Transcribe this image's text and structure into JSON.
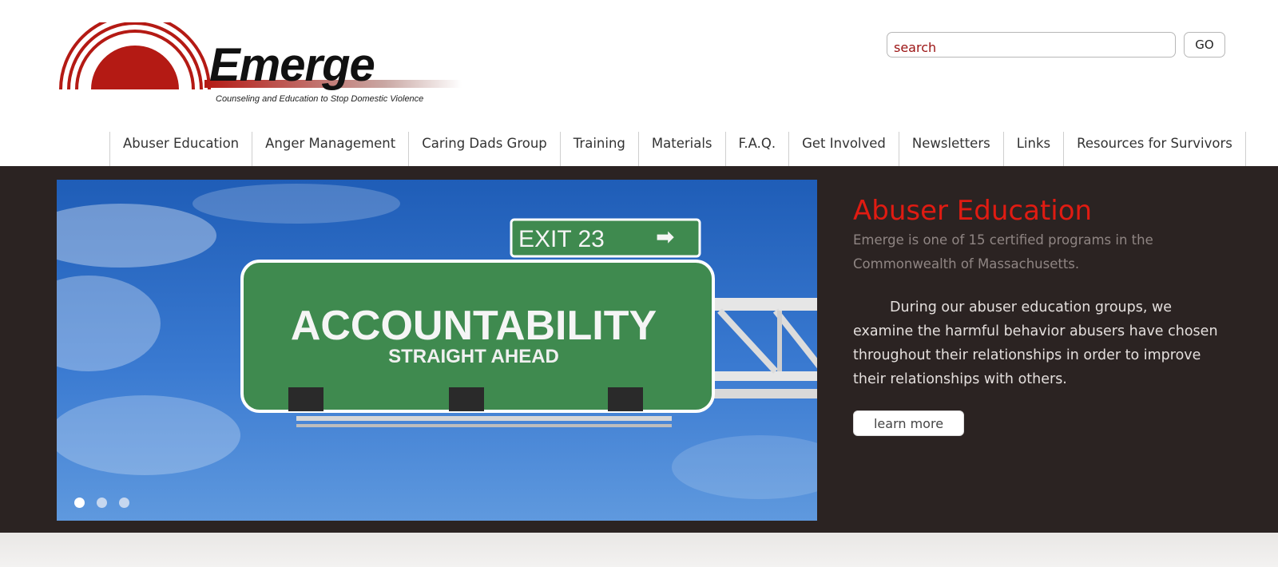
{
  "logo": {
    "wordmark": "Emerge",
    "tagline": "Counseling and Education to Stop Domestic Violence"
  },
  "search": {
    "placeholder": "search",
    "go_label": "GO"
  },
  "nav": {
    "items": [
      {
        "label": "Abuser Education"
      },
      {
        "label": "Anger Management"
      },
      {
        "label": "Caring Dads Group"
      },
      {
        "label": "Training"
      },
      {
        "label": "Materials"
      },
      {
        "label": "F.A.Q."
      },
      {
        "label": "Get Involved"
      },
      {
        "label": "Newsletters"
      },
      {
        "label": "Links"
      },
      {
        "label": "Resources for Survivors"
      }
    ]
  },
  "hero": {
    "sign_main": "ACCOUNTABILITY",
    "sign_sub": "STRAIGHT AHEAD",
    "exit_sign": "EXIT 23",
    "arrow_icon": "right-arrow-icon",
    "slides": 3,
    "active_slide": 1
  },
  "panel": {
    "title": "Abuser Education",
    "intro": "Emerge is one of 15 certified programs in the Commonwealth of Massachusetts.",
    "body": "During our abuser education groups, we examine the harmful behavior abusers have chosen throughout their relationships in order to improve their relationships with others.",
    "button_label": "learn more"
  },
  "colors": {
    "brand_red": "#b41a14",
    "title_red": "#e01b12",
    "band_dark": "#2b2322",
    "sign_green": "#3f8a4f",
    "sky_blue": "#2a68c3"
  }
}
